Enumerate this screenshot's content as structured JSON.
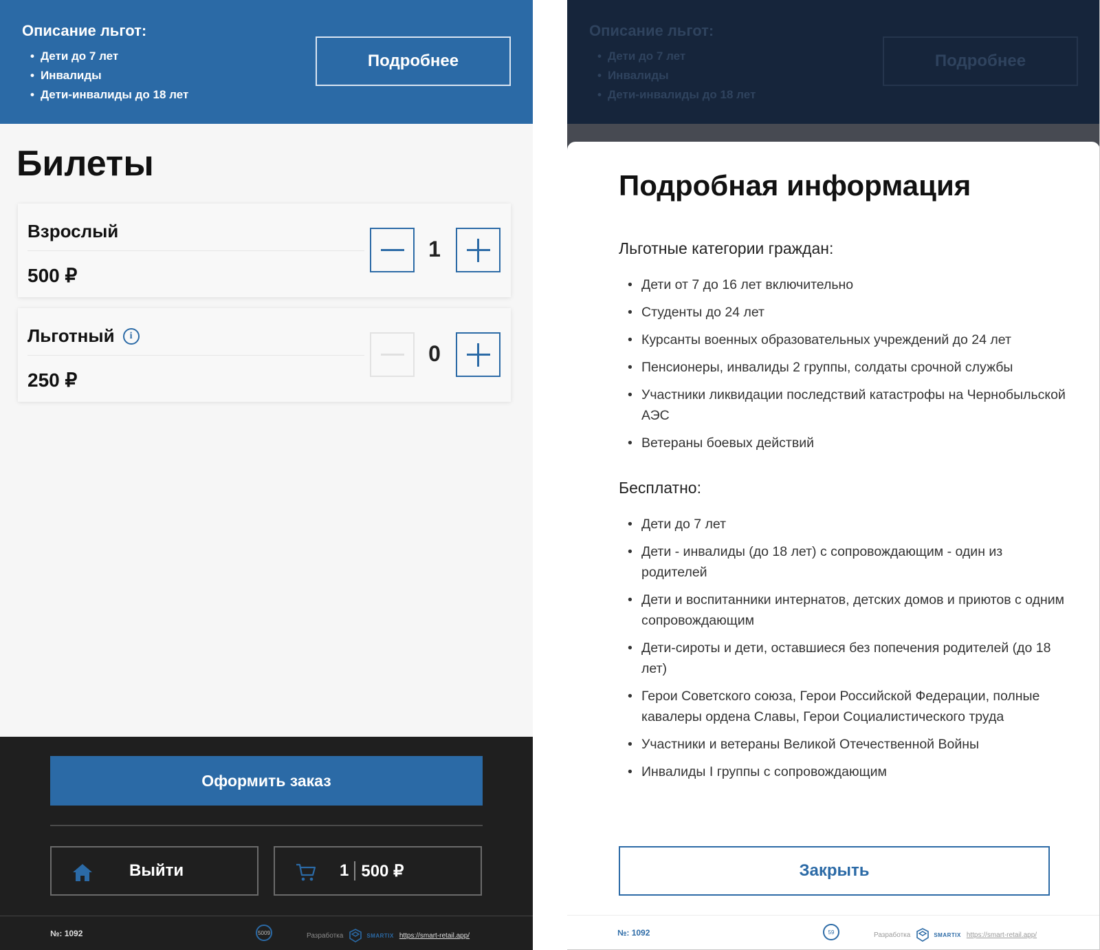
{
  "colors": {
    "accent": "#2b6aa6",
    "dark": "#1f1f1f",
    "overlay": "#474a52"
  },
  "banner": {
    "title": "Описание льгот:",
    "items": [
      "Дети до 7 лет",
      "Инвалиды",
      "Дети-инвалиды до 18 лет"
    ],
    "more_label": "Подробнее"
  },
  "tickets_title": "Билеты",
  "tickets": [
    {
      "name": "Взрослый",
      "price": "500 ₽",
      "qty": "1",
      "minus_enabled": true,
      "has_info": false
    },
    {
      "name": "Льготный",
      "price": "250 ₽",
      "qty": "0",
      "minus_enabled": false,
      "has_info": true
    }
  ],
  "bottom": {
    "order_label": "Оформить заказ",
    "exit_label": "Выйти",
    "cart_count": "1",
    "cart_total": "500 ₽"
  },
  "footer": {
    "number": "№: 1092",
    "badge_left": "5009",
    "badge_right": "59",
    "dev_label": "Разработка",
    "brand": "SMARTIX",
    "link": "https://smart-retail.app/"
  },
  "modal": {
    "title": "Подробная информация",
    "section1_title": "Льготные категории граждан:",
    "section1_items": [
      "Дети от 7 до 16 лет включительно",
      "Студенты до 24 лет",
      "Курсанты военных образовательных учреждений до 24 лет",
      "Пенсионеры, инвалиды 2 группы, солдаты срочной службы",
      "Участники ликвидации последствий катастрофы на Чернобыльской АЭС",
      "Ветераны боевых действий"
    ],
    "section2_title": "Бесплатно:",
    "section2_items": [
      "Дети до 7 лет",
      "Дети - инвалиды (до 18 лет) с сопровождающим - один из родителей",
      "Дети и воспитанники интернатов, детских домов и приютов с одним сопровождающим",
      "Дети-сироты и дети, оставшиеся без попечения родителей (до 18 лет)",
      "Герои Советского союза, Герои Российской Федерации, полные кавалеры ордена Славы, Герои Социалистического труда",
      "Участники и ветераны Великой Отечественной Войны",
      "Инвалиды I группы с сопровождающим"
    ],
    "close_label": "Закрыть"
  }
}
